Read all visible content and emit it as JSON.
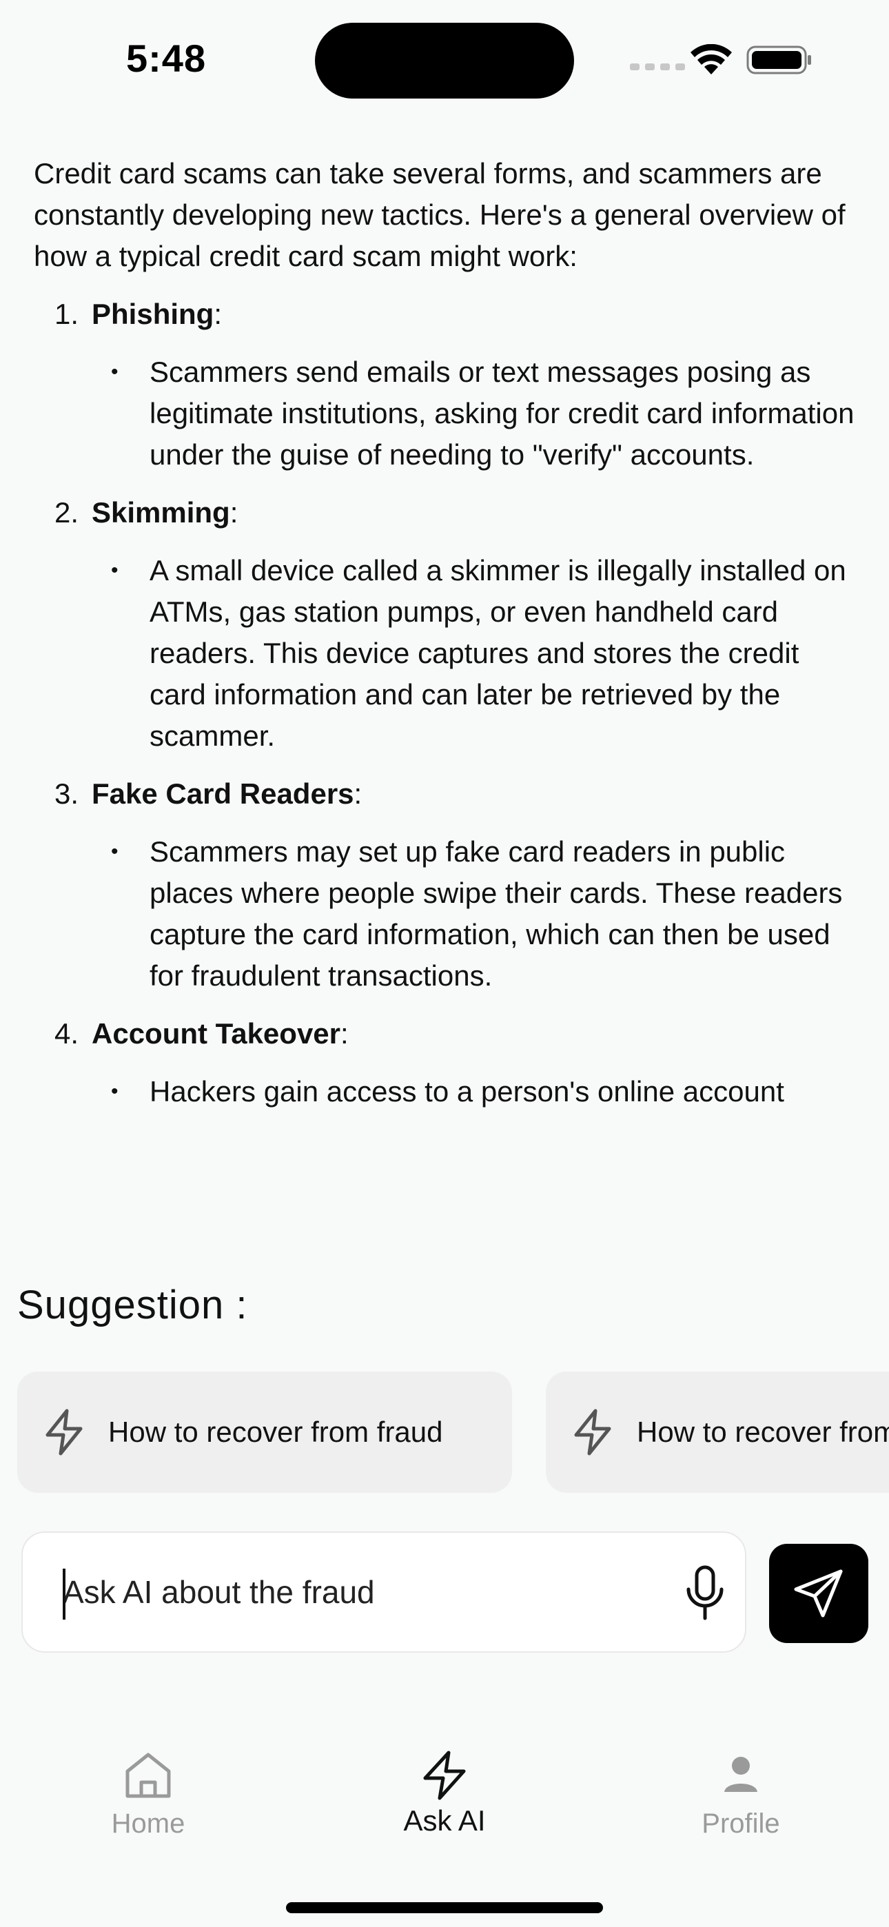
{
  "status_bar": {
    "time": "5:48"
  },
  "chat": {
    "intro": "Credit card scams can take several forms, and scammers are constantly developing new tactics. Here's a general overview of how a typical credit card scam might work:",
    "items": [
      {
        "number": "1.",
        "title": "Phishing",
        "suffix": ":",
        "bullet": "Scammers send emails or text messages posing as legitimate institutions, asking for credit card information under the guise of needing to \"verify\" accounts."
      },
      {
        "number": "2.",
        "title": "Skimming",
        "suffix": ":",
        "bullet": "A small device called a skimmer is illegally installed on ATMs, gas station pumps, or even handheld card readers. This device captures and stores the credit card information and can later be retrieved by the scammer."
      },
      {
        "number": "3.",
        "title": "Fake Card Readers",
        "suffix": ":",
        "bullet": "Scammers may set up fake card readers in public places where people swipe their cards. These readers capture the card information, which can then be used for fraudulent transactions."
      },
      {
        "number": "4.",
        "title": "Account Takeover",
        "suffix": ":",
        "bullet": "Hackers gain access to a person's online account"
      }
    ]
  },
  "suggestions": {
    "title": "Suggestion :",
    "items": [
      {
        "label": "How to recover from fraud",
        "icon": "lightning-icon"
      },
      {
        "label": "How to recover from fraud",
        "icon": "lightning-icon"
      }
    ]
  },
  "composer": {
    "placeholder": "Ask AI about the fraud",
    "value": ""
  },
  "nav": {
    "items": [
      {
        "label": "Home",
        "icon": "home-icon",
        "active": false
      },
      {
        "label": "Ask AI",
        "icon": "lightning-icon",
        "active": true
      },
      {
        "label": "Profile",
        "icon": "person-icon",
        "active": false
      }
    ]
  },
  "colors": {
    "background": "#f8faf9",
    "chip_background": "#efefef",
    "active_nav": "#111111",
    "inactive_nav": "#9a9a9a",
    "send_button": "#000000"
  }
}
